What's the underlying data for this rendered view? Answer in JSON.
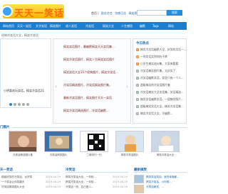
{
  "header": {
    "logo_text": "天天一笑话",
    "top_links": [
      "首页 |",
      "励志名言",
      "伤感日志",
      "搞笑图片"
    ],
    "search_placeholder": "",
    "search_button": "搜索"
  },
  "nav": {
    "items": [
      "网站首页",
      "天天一笑话",
      "文字笑话",
      "搞笑图片",
      "成人笑话",
      "冷笑话",
      "搞笑大全",
      "人生感悟",
      "幽默",
      "Tags",
      "网站"
    ]
  },
  "breadcrumb": "经典冷笑话大全，搞笑冷笑话",
  "left_panel": {
    "caption": "小明喜欢玩笑话，搞笑冷笑话21"
  },
  "slider": {
    "items": [
      "搞笑笑话图片，最幽默搞笑天天笑话集...",
      "搞笑冷笑话图片，搞笑人生搞笑笑话图片",
      "搞笑笑话大全15个经典图片，搞笑冷笑话...",
      "冷笑话精选图片，冷笑话搞笑图片集。",
      "最新冷笑话图片，搞笑图片天天一笑话",
      "搞笑冷笑话精选图片，冷笑话幽默..."
    ],
    "prev_arrow": "‹",
    "next_arrow": "›"
  },
  "right_panel": {
    "title": "今日热点",
    "items": [
      {
        "num": "1",
        "text": "搞笑冷笑话幽默大全，好笑的笑话一..."
      },
      {
        "num": "2",
        "text": "一则笑话笑到你肚子疼"
      },
      {
        "num": "3",
        "text": "小学生搞笑造句集，大家来看看"
      },
      {
        "num": "4",
        "text": "冷笑话搞笑图片集，太好笑了"
      },
      {
        "num": "5",
        "text": "冷笑话幽默笑话，家里只有一个人..."
      },
      {
        "num": "6",
        "text": "超级搞笑的冷笑话图片集"
      },
      {
        "num": "7",
        "text": "冷笑话搞笑大全笑话集，笑话精选..."
      },
      {
        "num": "8",
        "text": "搞笑笑话幽默笑话，一组搞笑图片..."
      },
      {
        "num": "9",
        "text": "超级搞笑笑话大全，搞笑冷笑话集..."
      },
      {
        "num": "10",
        "text": "搞笑冷笑话大全，冷幽默..."
      }
    ]
  },
  "pictures_section": {
    "title": "门图片",
    "items": [
      {
        "caption": "冷笑话精选图片集"
      },
      {
        "caption": "冷笑话搞笑图片"
      },
      {
        "caption": "二维码扫一扫"
      },
      {
        "caption": "搞笑冷笑话图片"
      },
      {
        "caption": "搞笑冷笑话大全"
      }
    ]
  },
  "bottom": {
    "col1_title": "天一笑话",
    "col1_items": [
      "超级好笑的冷笑话，太好笑",
      "一个笑话让你笑翻天",
      "冷笑话搞笑图片大全"
    ],
    "col1_dates": [
      "2019-04-19",
      "2019-04-19",
      "2019-04-19"
    ],
    "col2_title": "冷笑话",
    "col2_items": [
      "搞笑冷笑话大全，一年轻...",
      "搞笑冷笑话大全，一年轻...",
      "冷笑话一则，自己做人..."
    ],
    "col2_dates": [
      "2019-04-19",
      "2019-04-19",
      "2019-04-19"
    ],
    "col3_title": "最新搞笑",
    "col3_items": [
      "搞笑笑话笑话，我的幸福都...",
      "搞笑冷笑话，小时候...",
      "冷笑话精选，..."
    ]
  },
  "colors": {
    "nav_bg": "#1a7fd0",
    "accent": "#1a6ab0",
    "logo_yellow": "#ffc400"
  }
}
